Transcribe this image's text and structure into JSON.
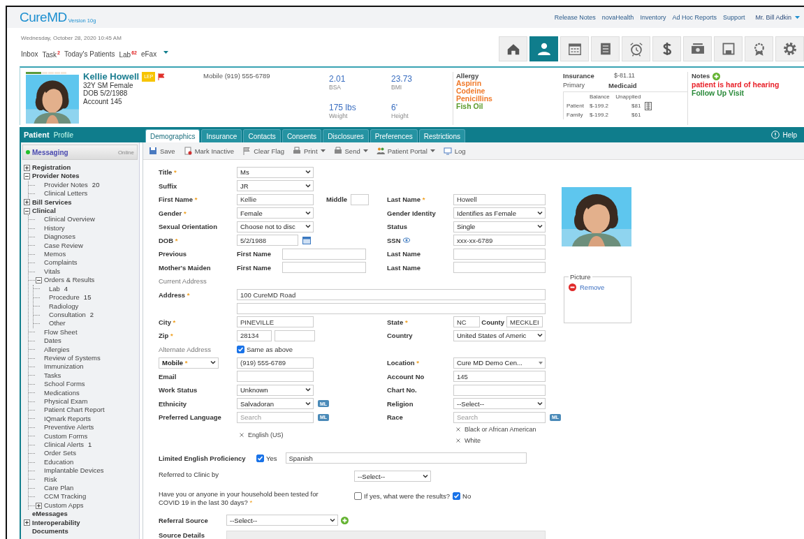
{
  "header": {
    "logo": "CureMD",
    "version": "Version 10g",
    "links": [
      "Release Notes",
      "novaHealth",
      "Inventory",
      "Ad Hoc Reports",
      "Support"
    ],
    "user": "Mr. Bill Adkin"
  },
  "date": "Wednesday, October 28, 2020 10:45 AM",
  "nav": [
    {
      "label": "Inbox"
    },
    {
      "label": "Task",
      "badge": "2"
    },
    {
      "label": "Today's Patients"
    },
    {
      "label": "Lab",
      "badge": "62"
    },
    {
      "label": "eFax",
      "menu": true
    }
  ],
  "toolbar_icons": [
    {
      "kind": "home",
      "selected": false
    },
    {
      "kind": "patient",
      "selected": true
    },
    {
      "kind": "calendar",
      "selected": false
    },
    {
      "kind": "document",
      "selected": false
    },
    {
      "kind": "alarm",
      "selected": false
    },
    {
      "kind": "dollar",
      "selected": false
    },
    {
      "kind": "cash",
      "selected": false
    },
    {
      "kind": "save",
      "selected": false
    },
    {
      "kind": "badge",
      "selected": false
    },
    {
      "kind": "gear",
      "selected": false
    }
  ],
  "patient": {
    "name": "Kellie Howell",
    "badge": "LEP",
    "flagged": true,
    "age_sex": "32Y SM Female",
    "dob": "DOB 5/2/1988",
    "account": "Account 145",
    "phone_label": "Mobile",
    "phone": "(919) 555-6789",
    "vitals": [
      {
        "value": "2.01",
        "label": "BSA"
      },
      {
        "value": "23.73",
        "label": "BMI"
      },
      {
        "value": "175 lbs",
        "label": "Weight"
      },
      {
        "value": "6'",
        "label": "Height"
      }
    ],
    "allergy": {
      "title": "Allergy",
      "items": [
        {
          "name": "Aspirin",
          "color": "#f07828"
        },
        {
          "name": "Codeine",
          "color": "#f07828"
        },
        {
          "name": "Penicillins",
          "color": "#f07828"
        },
        {
          "name": "Fish Oil",
          "color": "#5a9a2a"
        }
      ]
    },
    "insurance": {
      "title": "Insurance",
      "amount": "$-81.11",
      "primary_label": "Primary",
      "primary": "Medicaid",
      "columns": [
        "Balance",
        "Unapplied"
      ],
      "rows": [
        {
          "label": "Patient",
          "balance": "$-199.2",
          "unapplied": "$81"
        },
        {
          "label": "Family",
          "balance": "$-199.2",
          "unapplied": "$61"
        }
      ]
    },
    "notes": {
      "title": "Notes",
      "items": [
        {
          "text": "patient is hard of hearing",
          "color": "#e82028"
        },
        {
          "text": "Follow Up Visit",
          "color": "#2a8a3a"
        }
      ]
    }
  },
  "sidebar": {
    "title": "Patient",
    "subtitle": "Profile",
    "messaging": {
      "label": "Messaging",
      "status": "Online",
      "online": true
    },
    "tree": [
      {
        "label": "Registration",
        "expanded": false
      },
      {
        "label": "Provider Notes",
        "expanded": true,
        "children": [
          {
            "label": "Provider Notes",
            "count": "20"
          },
          {
            "label": "Clinical Letters"
          }
        ]
      },
      {
        "label": "Bill Services",
        "expanded": false
      },
      {
        "label": "Clinical",
        "expanded": true,
        "children": [
          {
            "label": "Clinical Overview"
          },
          {
            "label": "History"
          },
          {
            "label": "Diagnoses"
          },
          {
            "label": "Case Review"
          },
          {
            "label": "Memos"
          },
          {
            "label": "Complaints"
          },
          {
            "label": "Vitals"
          },
          {
            "label": "Orders & Results",
            "expanded": true,
            "children": [
              {
                "label": "Lab",
                "count": "4"
              },
              {
                "label": "Procedure",
                "count": "15"
              },
              {
                "label": "Radiology"
              },
              {
                "label": "Consultation",
                "count": "2"
              },
              {
                "label": "Other"
              }
            ]
          },
          {
            "label": "Flow Sheet"
          },
          {
            "label": "Dates"
          },
          {
            "label": "Allergies"
          },
          {
            "label": "Review of Systems"
          },
          {
            "label": "Immunization"
          },
          {
            "label": "Tasks"
          },
          {
            "label": "School Forms"
          },
          {
            "label": "Medications"
          },
          {
            "label": "Physical Exam"
          },
          {
            "label": "Patient Chart Report"
          },
          {
            "label": "IQmark Reports"
          },
          {
            "label": "Preventive Alerts"
          },
          {
            "label": "Custom Forms"
          },
          {
            "label": "Clinical Alerts",
            "count": "1"
          },
          {
            "label": "Order Sets"
          },
          {
            "label": "Education"
          },
          {
            "label": "Implantable Devices"
          },
          {
            "label": "Risk"
          },
          {
            "label": "Care Plan"
          },
          {
            "label": "CCM Tracking"
          },
          {
            "label": "Custom Apps",
            "expanded": false
          }
        ]
      },
      {
        "label": "eMessages"
      },
      {
        "label": "Interoperability",
        "expanded": false
      },
      {
        "label": "Documents"
      }
    ]
  },
  "tabs": [
    {
      "label": "Demographics",
      "selected": true
    },
    {
      "label": "Insurance",
      "selected": false
    },
    {
      "label": "Contacts",
      "selected": false
    },
    {
      "label": "Consents",
      "selected": false
    },
    {
      "label": "Disclosures",
      "selected": false
    },
    {
      "label": "Preferences",
      "selected": false
    },
    {
      "label": "Restrictions",
      "selected": false
    }
  ],
  "help": "Help",
  "actions": [
    {
      "label": "Save",
      "kind": "save",
      "menu": false
    },
    {
      "label": "Mark Inactive",
      "kind": "inactive",
      "menu": false
    },
    {
      "label": "Clear Flag",
      "kind": "flag",
      "menu": false
    },
    {
      "label": "Print",
      "kind": "print",
      "menu": true
    },
    {
      "label": "Send",
      "kind": "send",
      "menu": true
    },
    {
      "label": "Patient Portal",
      "kind": "portal",
      "menu": true
    },
    {
      "label": "Log",
      "kind": "log",
      "menu": false
    }
  ],
  "form": {
    "rows": [
      {
        "kind": "grid",
        "label": {
          "text": "Title",
          "mark": "*"
        },
        "field": {
          "kind": "select",
          "value": "Ms"
        }
      },
      {
        "kind": "grid",
        "label": {
          "text": "Suffix"
        },
        "field": {
          "kind": "select",
          "value": "JR"
        }
      },
      {
        "kind": "grid",
        "label": {
          "text": "First Name",
          "mark": "*"
        },
        "field": {
          "kind": "input",
          "value": "Kellie"
        },
        "middle_label": {
          "text": "Middle"
        },
        "middle_field": {
          "kind": "input"
        },
        "right_label": {
          "text": "Last Name",
          "mark": "*"
        },
        "right_field": {
          "kind": "input",
          "value": "Howell"
        }
      },
      {
        "kind": "grid",
        "label": {
          "text": "Gender",
          "mark": "*"
        },
        "field": {
          "kind": "select",
          "value": "Female"
        },
        "right_label": {
          "text": "Gender Identity"
        },
        "right_field": {
          "kind": "select",
          "value": "Identifies as Female"
        }
      },
      {
        "kind": "grid",
        "label": {
          "text": "Sexual Orientation"
        },
        "field": {
          "kind": "select",
          "value": "Choose not to disc"
        },
        "right_label": {
          "text": "Status"
        },
        "right_field": {
          "kind": "select",
          "value": "Single"
        }
      },
      {
        "kind": "grid",
        "label": {
          "text": "DOB",
          "mark": "*"
        },
        "field": {
          "kind": "date",
          "value": "5/2/1988"
        },
        "right_label": {
          "text": "SSN",
          "kind": "reveal"
        },
        "right_field": {
          "kind": "input",
          "value": "xxx-xx-6789"
        }
      },
      {
        "kind": "grid",
        "label": {
          "text": "Previous"
        },
        "field": {
          "kind": "named_input",
          "sublabel": "First Name"
        },
        "right_label": {
          "text": "Last Name"
        },
        "right_field": {
          "kind": "input"
        }
      },
      {
        "kind": "grid",
        "label": {
          "text": "Mother's Maiden"
        },
        "field": {
          "kind": "named_input",
          "sublabel": "First Name"
        },
        "right_label": {
          "text": "Last Name"
        },
        "right_field": {
          "kind": "input"
        }
      },
      {
        "kind": "grid",
        "label": {
          "text": "Current Address",
          "kind": "section"
        }
      },
      {
        "kind": "grid",
        "label": {
          "text": "Address",
          "mark": "*"
        },
        "field": {
          "kind": "wide_input",
          "value": "100 CureMD Road"
        }
      },
      {
        "kind": "grid",
        "field": {
          "kind": "wide_input"
        }
      },
      {
        "kind": "grid",
        "label": {
          "text": "City",
          "mark": "*"
        },
        "field": {
          "kind": "input",
          "value": "PINEVILLE"
        },
        "right_label": {
          "text": "State",
          "mark": "*"
        },
        "right_field": {
          "kind": "state_county",
          "value": "NC",
          "sublabel": "County",
          "value2": "MECKLEI"
        }
      },
      {
        "kind": "grid",
        "label": {
          "text": "Zip",
          "mark": "*"
        },
        "field": {
          "kind": "zip",
          "value": "28134"
        },
        "right_label": {
          "text": "Country"
        },
        "right_field": {
          "kind": "select",
          "value": "United States of Americ"
        }
      },
      {
        "kind": "grid",
        "label": {
          "text": "Alternate Address",
          "kind": "section"
        },
        "field": {
          "kind": "checkbox",
          "checked": true,
          "text": "Same as above"
        }
      },
      {
        "kind": "grid",
        "label": {
          "text": "Mobile",
          "mark": "*",
          "kind": "select"
        },
        "field": {
          "kind": "input",
          "value": "(919) 555-6789"
        },
        "right_label": {
          "text": "Location",
          "mark": "*"
        },
        "right_field": {
          "kind": "combo",
          "value": "Cure MD Demo Cen..."
        }
      },
      {
        "kind": "grid",
        "label": {
          "text": "Email"
        },
        "field": {
          "kind": "input"
        },
        "right_label": {
          "text": "Account No"
        },
        "right_field": {
          "kind": "input",
          "value": "145"
        }
      },
      {
        "kind": "grid",
        "label": {
          "text": "Work Status"
        },
        "field": {
          "kind": "select",
          "value": "Unknown"
        },
        "right_label": {
          "text": "Chart No."
        },
        "right_field": {
          "kind": "input"
        }
      },
      {
        "kind": "grid",
        "label": {
          "text": "Ethnicity"
        },
        "field": {
          "kind": "select",
          "value": "Salvadoran",
          "button": "ML"
        },
        "right_label": {
          "text": "Religion"
        },
        "right_field": {
          "kind": "select",
          "value": "--Select--"
        }
      },
      {
        "kind": "grid",
        "label": {
          "text": "Preferred Language"
        },
        "field": {
          "kind": "input",
          "placeholder": "Search",
          "button": "ML"
        },
        "right_label": {
          "text": "Race"
        },
        "right_field": {
          "kind": "input",
          "placeholder": "Search",
          "button": "ML"
        }
      },
      {
        "kind": "grid",
        "field": {
          "kind": "chips",
          "items": [
            "English (US)"
          ]
        },
        "right_field": {
          "kind": "chips",
          "items": [
            "Black or African American",
            "White"
          ]
        }
      },
      {
        "kind": "wide",
        "label": {
          "text": "Limited English Proficiency"
        },
        "field": {
          "kind": "check_input",
          "checked": true,
          "text": "Yes",
          "value": "Spanish"
        }
      },
      {
        "kind": "long",
        "label": {
          "text": "Referred to Clinic by"
        },
        "field": {
          "kind": "select",
          "value": "--Select--"
        }
      },
      {
        "kind": "long",
        "label": {
          "text": "Have you or anyone in your household been tested for COVID 19 in the last 30 days?",
          "mark": "*"
        },
        "field": {
          "kind": "checks",
          "items": [
            {
              "text": "If yes, what were the results?",
              "checked": false
            },
            {
              "text": "No",
              "checked": true
            }
          ]
        }
      },
      {
        "kind": "compact",
        "label": {
          "text": "Referral Source"
        },
        "field": {
          "kind": "select",
          "value": "--Select--",
          "add": true
        }
      },
      {
        "kind": "compact",
        "label": {
          "text": "Source Details"
        },
        "field": {
          "kind": "textarea"
        }
      }
    ],
    "picture_panel": {
      "title": "Picture",
      "action": "Remove"
    }
  }
}
